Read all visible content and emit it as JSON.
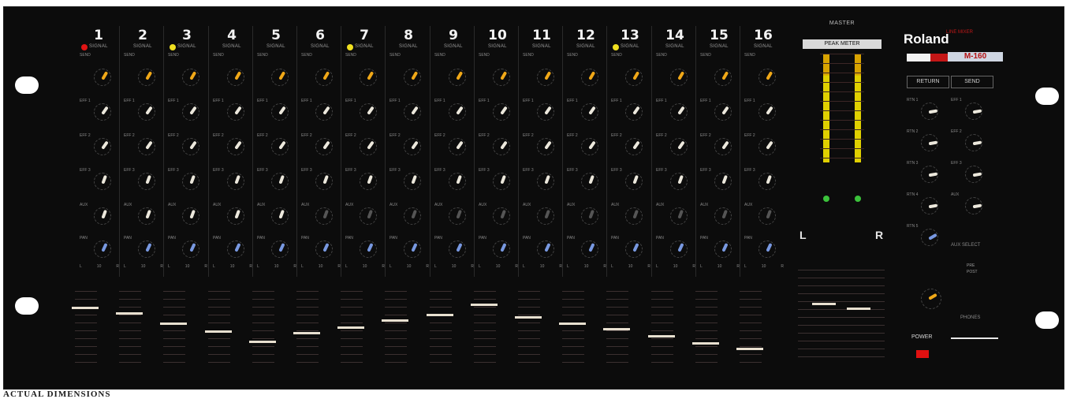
{
  "channels": [
    {
      "number": "1",
      "signal_label": "SIGNAL",
      "led_color": "#e01414",
      "send_label": "SEND"
    },
    {
      "number": "2",
      "signal_label": "SIGNAL",
      "led_color": "",
      "send_label": "SEND"
    },
    {
      "number": "3",
      "signal_label": "SIGNAL",
      "led_color": "#f0e020",
      "send_label": "SEND"
    },
    {
      "number": "4",
      "signal_label": "SIGNAL",
      "led_color": "",
      "send_label": "SEND"
    },
    {
      "number": "5",
      "signal_label": "SIGNAL",
      "led_color": "",
      "send_label": "SEND"
    },
    {
      "number": "6",
      "signal_label": "SIGNAL",
      "led_color": "",
      "send_label": "SEND"
    },
    {
      "number": "7",
      "signal_label": "SIGNAL",
      "led_color": "#f0e020",
      "send_label": "SEND"
    },
    {
      "number": "8",
      "signal_label": "SIGNAL",
      "led_color": "",
      "send_label": "SEND"
    },
    {
      "number": "9",
      "signal_label": "SIGNAL",
      "led_color": "",
      "send_label": "SEND"
    },
    {
      "number": "10",
      "signal_label": "SIGNAL",
      "led_color": "",
      "send_label": "SEND"
    },
    {
      "number": "11",
      "signal_label": "SIGNAL",
      "led_color": "",
      "send_label": "SEND"
    },
    {
      "number": "12",
      "signal_label": "SIGNAL",
      "led_color": "",
      "send_label": "SEND"
    },
    {
      "number": "13",
      "signal_label": "SIGNAL",
      "led_color": "#f0e020",
      "send_label": "SEND"
    },
    {
      "number": "14",
      "signal_label": "SIGNAL",
      "led_color": "",
      "send_label": "SEND"
    },
    {
      "number": "15",
      "signal_label": "SIGNAL",
      "led_color": "",
      "send_label": "SEND"
    },
    {
      "number": "16",
      "signal_label": "SIGNAL",
      "led_color": "",
      "send_label": "SEND"
    }
  ],
  "knob_labels": [
    "EFF 1",
    "EFF 2",
    "EFF 3",
    "AUX",
    "PAN"
  ],
  "pan_scale": [
    "L",
    "10",
    "R"
  ],
  "knob_colors": {
    "send": "#f0a818",
    "eff": "#ece8dc",
    "pan": "#7898e0"
  },
  "fader_levels": [
    0.78,
    0.7,
    0.55,
    0.45,
    0.3,
    0.42,
    0.5,
    0.6,
    0.68,
    0.82,
    0.65,
    0.55,
    0.48,
    0.38,
    0.28,
    0.2
  ],
  "master": {
    "title": "MASTER",
    "peak_meter_label": "PEAK METER",
    "left_label": "L",
    "right_label": "R",
    "left_fader_level": 0.62,
    "right_fader_level": 0.56
  },
  "brand": {
    "name": "Roland",
    "sub": "LINE MIXER",
    "model": "M-160"
  },
  "return_section": {
    "title": "RETURN",
    "knobs": [
      "RTN 1",
      "RTN 2",
      "RTN 3",
      "RTN 4",
      "RTN 5"
    ]
  },
  "send_section": {
    "title": "SEND",
    "knobs": [
      "EFF 1",
      "EFF 2",
      "EFF 3",
      "AUX"
    ]
  },
  "aux_select": {
    "label": "AUX SELECT",
    "pre": "PRE",
    "post": "POST"
  },
  "phones_label": "PHONES",
  "power_label": "POWER",
  "caption": "ACTUAL DIMENSIONS"
}
